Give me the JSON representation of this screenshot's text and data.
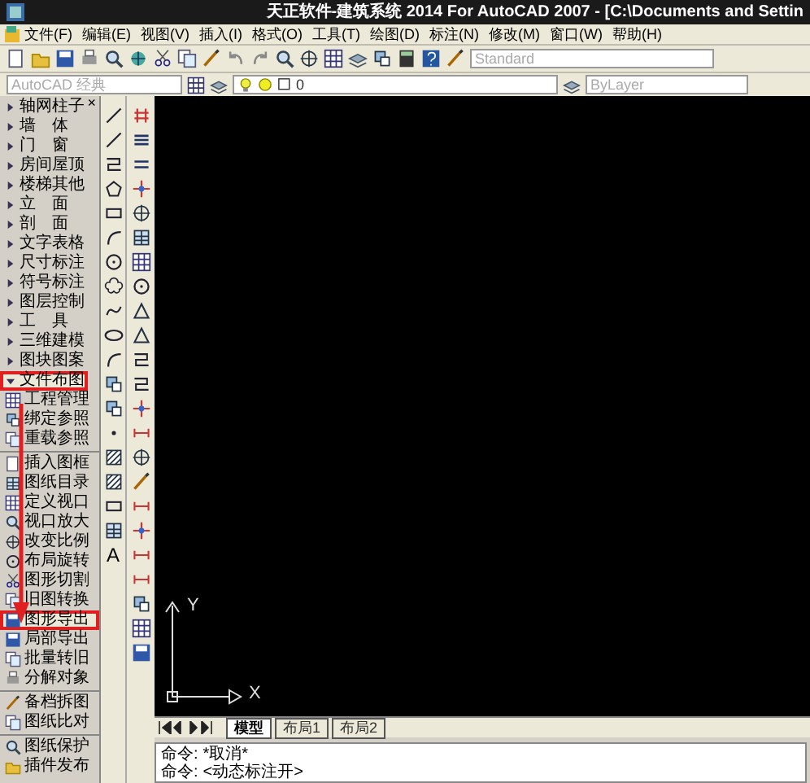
{
  "window": {
    "title": "天正软件-建筑系统 2014  For AutoCAD 2007 - [C:\\Documents and Settin"
  },
  "menu": [
    "文件(F)",
    "编辑(E)",
    "视图(V)",
    "插入(I)",
    "格式(O)",
    "工具(T)",
    "绘图(D)",
    "标注(N)",
    "修改(M)",
    "窗口(W)",
    "帮助(H)"
  ],
  "toolbar": {
    "text_style": "Standard",
    "workspace": "AutoCAD 经典",
    "layer": "0",
    "linetype": "ByLayer"
  },
  "palette": {
    "close": "×",
    "items": [
      {
        "label": "轴网柱子",
        "expanded": false,
        "highlighted": false
      },
      {
        "label": "墙　体",
        "expanded": false,
        "highlighted": false
      },
      {
        "label": "门　窗",
        "expanded": false,
        "highlighted": false
      },
      {
        "label": "房间屋顶",
        "expanded": false,
        "highlighted": false
      },
      {
        "label": "楼梯其他",
        "expanded": false,
        "highlighted": false
      },
      {
        "label": "立　面",
        "expanded": false,
        "highlighted": false
      },
      {
        "label": "剖　面",
        "expanded": false,
        "highlighted": false
      },
      {
        "label": "文字表格",
        "expanded": false,
        "highlighted": false
      },
      {
        "label": "尺寸标注",
        "expanded": false,
        "highlighted": false
      },
      {
        "label": "符号标注",
        "expanded": false,
        "highlighted": false
      },
      {
        "label": "图层控制",
        "expanded": false,
        "highlighted": false
      },
      {
        "label": "工　具",
        "expanded": false,
        "highlighted": false
      },
      {
        "label": "三维建模",
        "expanded": false,
        "highlighted": false
      },
      {
        "label": "图块图案",
        "expanded": false,
        "highlighted": false
      },
      {
        "label": "文件布图",
        "expanded": true,
        "highlighted": true,
        "children": [
          {
            "kind": "command",
            "label": "工程管理",
            "highlighted": false
          },
          {
            "kind": "command",
            "label": "绑定参照",
            "highlighted": false
          },
          {
            "kind": "command",
            "label": "重载参照",
            "highlighted": false
          },
          {
            "kind": "separator"
          },
          {
            "kind": "command",
            "label": "插入图框",
            "highlighted": false
          },
          {
            "kind": "command",
            "label": "图纸目录",
            "highlighted": false
          },
          {
            "kind": "command",
            "label": "定义视口",
            "highlighted": false
          },
          {
            "kind": "command",
            "label": "视口放大",
            "highlighted": false
          },
          {
            "kind": "command",
            "label": "改变比例",
            "highlighted": false
          },
          {
            "kind": "command",
            "label": "布局旋转",
            "highlighted": false
          },
          {
            "kind": "command",
            "label": "图形切割",
            "highlighted": false
          },
          {
            "kind": "command",
            "label": "旧图转换",
            "highlighted": false
          },
          {
            "kind": "command",
            "label": "图形导出",
            "highlighted": true
          },
          {
            "kind": "command",
            "label": "局部导出",
            "highlighted": false
          },
          {
            "kind": "command",
            "label": "批量转旧",
            "highlighted": false
          },
          {
            "kind": "command",
            "label": "分解对象",
            "highlighted": false
          },
          {
            "kind": "separator"
          },
          {
            "kind": "command",
            "label": "备档拆图",
            "highlighted": false
          },
          {
            "kind": "command",
            "label": "图纸比对",
            "highlighted": false
          },
          {
            "kind": "separator"
          },
          {
            "kind": "command",
            "label": "图纸保护",
            "highlighted": false
          },
          {
            "kind": "command",
            "label": "插件发布",
            "highlighted": false
          }
        ]
      }
    ]
  },
  "draw_toolbar": {
    "text_tool": "A"
  },
  "ucs": {
    "y_label": "Y",
    "x_label": "X"
  },
  "layout_tabs": [
    {
      "label": "模型",
      "selected": true
    },
    {
      "label": "布局1",
      "selected": false
    },
    {
      "label": "布局2",
      "selected": false
    }
  ],
  "command_lines": [
    {
      "prompt": "命令:",
      "text": "*取消*"
    },
    {
      "prompt": "命令:",
      "text": "<动态标注开>"
    }
  ]
}
